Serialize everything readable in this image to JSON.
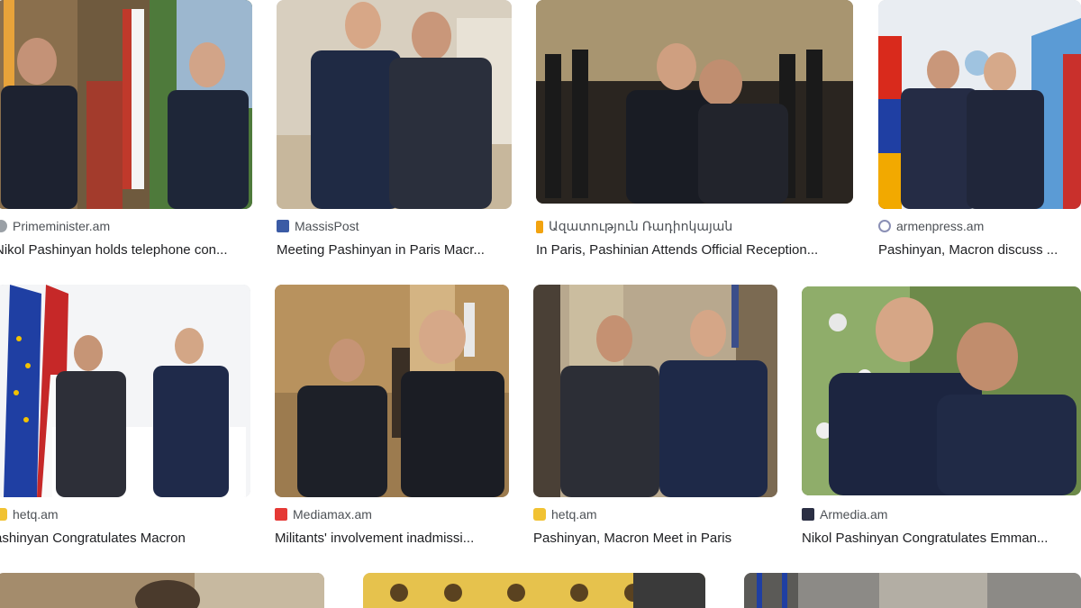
{
  "results": [
    {
      "source": "Primeminister.am",
      "title": "Nikol Pashinyan holds telephone con...",
      "favicon": "primeminister-favicon",
      "favicon_color": "#9aa0a6"
    },
    {
      "source": "MassisPost",
      "title": "Meeting Pashinyan in Paris Macr...",
      "favicon": "massispost-favicon",
      "favicon_color": "#3b5ba5"
    },
    {
      "source": "Ազատություն Ռադիոկայան",
      "title": "In Paris, Pashinian Attends Official Reception...",
      "favicon": "azatutyun-favicon",
      "favicon_color": "#f2a30f"
    },
    {
      "source": "armenpress.am",
      "title": "Pashinyan, Macron discuss ...",
      "favicon": "armenpress-favicon",
      "favicon_color": "#8a8fb5"
    },
    {
      "source": "hetq.am",
      "title": "ashinyan Congratulates Macron",
      "favicon": "hetq-favicon",
      "favicon_color": "#f1c232"
    },
    {
      "source": "Mediamax.am",
      "title": "Militants' involvement inadmissi...",
      "favicon": "mediamax-favicon",
      "favicon_color": "#e53935"
    },
    {
      "source": "hetq.am",
      "title": "Pashinyan, Macron Meet in Paris",
      "favicon": "hetq-favicon",
      "favicon_color": "#f1c232"
    },
    {
      "source": "Armedia.am",
      "title": "Nikol Pashinyan Congratulates Emman...",
      "favicon": "armedia-favicon",
      "favicon_color": "#2b2f44"
    }
  ]
}
